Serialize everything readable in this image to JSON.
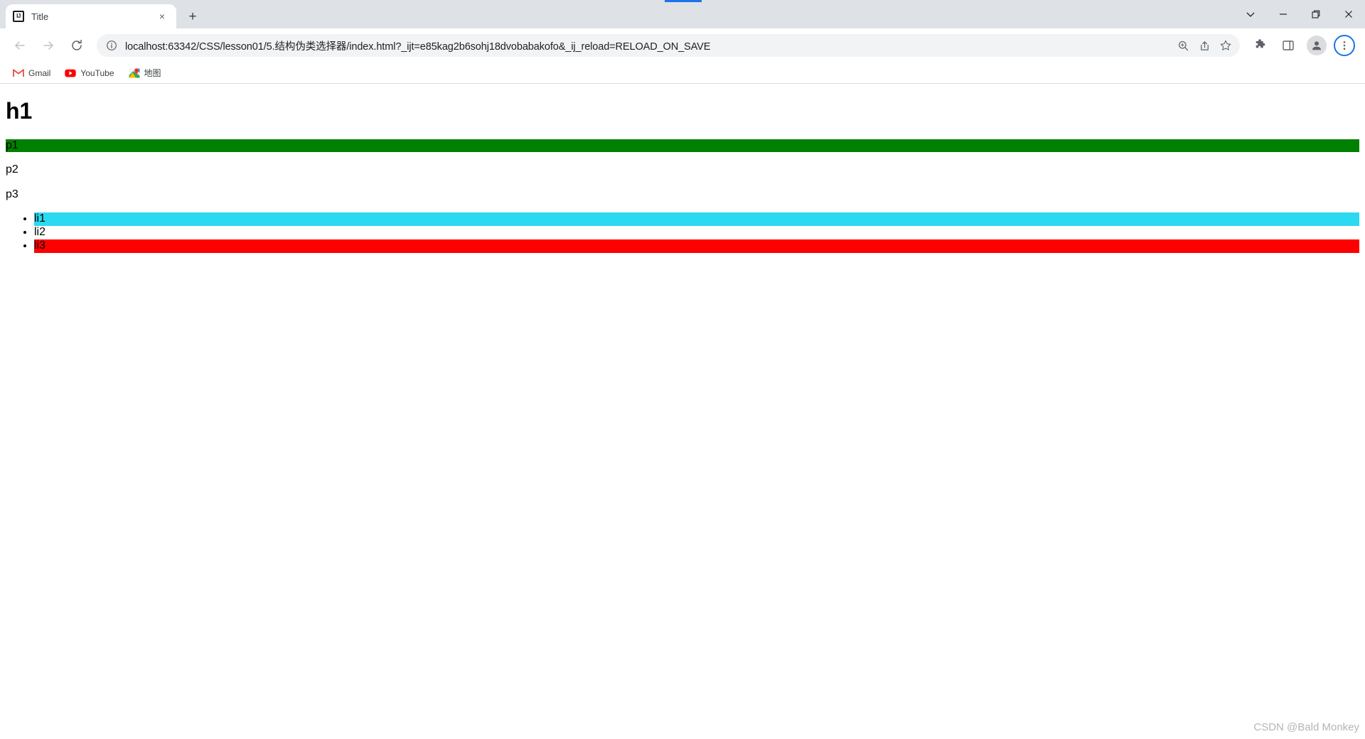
{
  "window": {
    "controls": [
      {
        "name": "tab-search-button",
        "glyph": "chevron-down"
      },
      {
        "name": "minimize-button",
        "glyph": "minimize"
      },
      {
        "name": "maximize-button",
        "glyph": "maximize"
      },
      {
        "name": "close-button",
        "glyph": "close"
      }
    ]
  },
  "tabs": [
    {
      "title": "Title",
      "favicon_label": "IJ",
      "close_glyph": "×"
    }
  ],
  "newtab": {
    "label": "+"
  },
  "toolbar": {
    "back_label": "←",
    "forward_label": "→",
    "reload_label": "↻",
    "url": "localhost:63342/CSS/lesson01/5.结构伪类选择器/index.html?_ijt=e85kag2b6sohj18dvobabakofo&_ij_reload=RELOAD_ON_SAVE",
    "url_placeholder": "Search Google or type a URL",
    "omnibox_actions": [
      "zoom-icon",
      "share-icon",
      "bookmark-star-icon"
    ],
    "right_actions": [
      "extensions-icon",
      "side-panel-icon",
      "profile-avatar",
      "chrome-menu-icon"
    ],
    "menu_ring_color": "#1a73e8"
  },
  "bookmarks": [
    {
      "label": "Gmail",
      "icon": "gmail-icon"
    },
    {
      "label": "YouTube",
      "icon": "youtube-icon"
    },
    {
      "label": "地图",
      "icon": "google-maps-icon"
    }
  ],
  "page": {
    "heading": "h1",
    "paragraphs": [
      {
        "text": "p1",
        "background": "#008000"
      },
      {
        "text": "p2",
        "background": "transparent"
      },
      {
        "text": "p3",
        "background": "transparent"
      }
    ],
    "list_items": [
      {
        "text": "li1",
        "background": "#2bd9f0"
      },
      {
        "text": "li2",
        "background": "transparent"
      },
      {
        "text": "li3",
        "background": "#ff0000"
      }
    ]
  },
  "watermark": {
    "text": "CSDN @Bald Monkey"
  }
}
